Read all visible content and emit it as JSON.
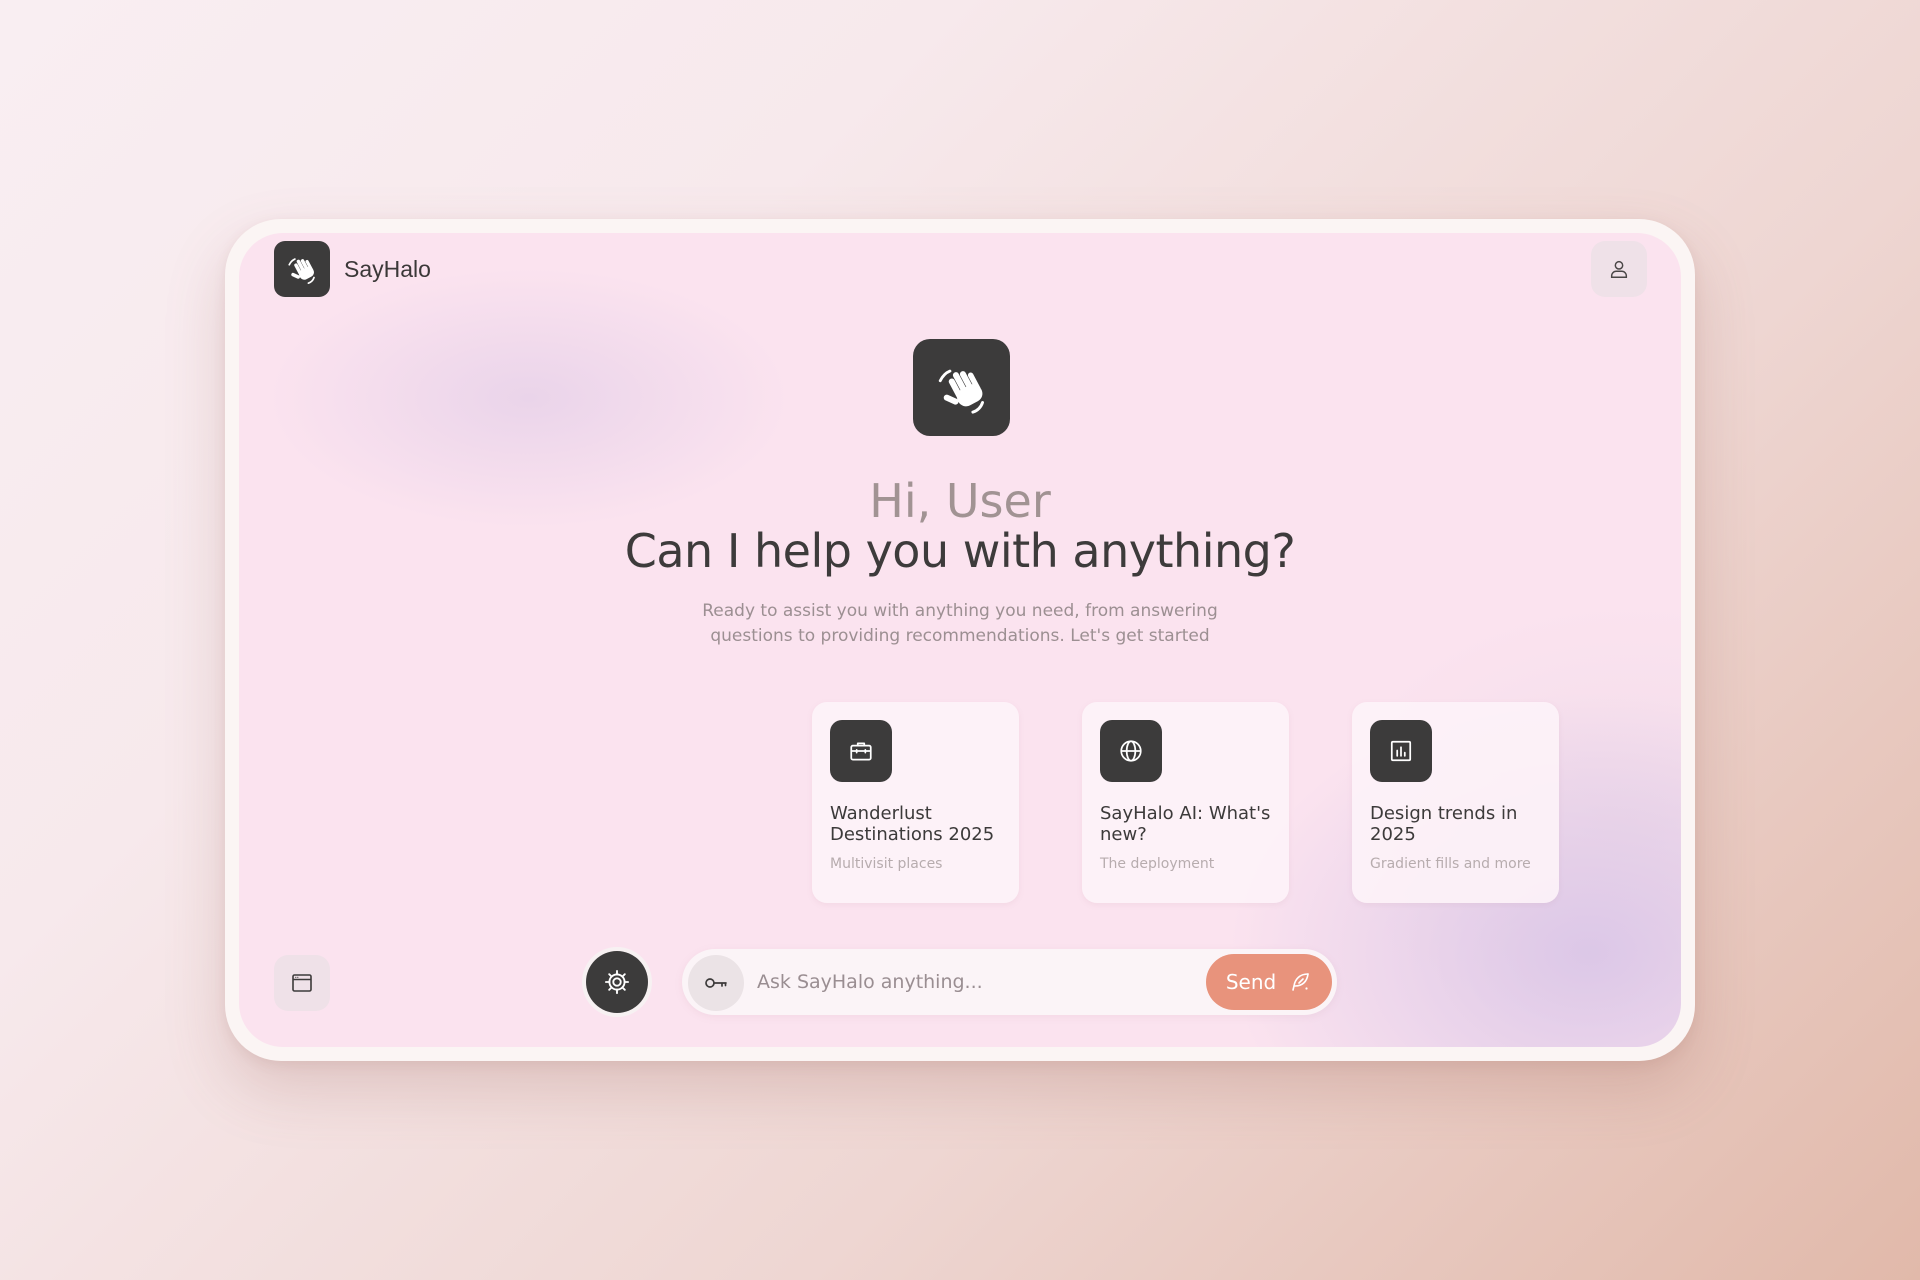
{
  "app": {
    "brand_name": "SayHalo"
  },
  "hero": {
    "greeting": "Hi, User",
    "question": "Can I help you with anything?",
    "subtitle": "Ready to assist you with anything you need, from answering questions to providing recommendations. Let's get started"
  },
  "cards": [
    {
      "icon": "briefcase-icon",
      "title": "Wanderlust Destinations 2025",
      "subtitle": "Multivisit places"
    },
    {
      "icon": "globe-icon",
      "title": "SayHalo AI: What's new?",
      "subtitle": "The deployment"
    },
    {
      "icon": "bar-chart-icon",
      "title": "Design trends in 2025",
      "subtitle": "Gradient fills and more"
    }
  ],
  "composer": {
    "placeholder": "Ask SayHalo anything...",
    "send_label": "Send"
  },
  "icons": {
    "logo": "waving-hand-icon",
    "profile": "user-icon",
    "sidebar": "browser-window-icon",
    "settings": "gear-icon",
    "key": "key-icon",
    "send": "feather-pen-icon"
  },
  "colors": {
    "accent": "#e8937c",
    "dark_tile": "#3c3b3b",
    "panel": "#fbe3ef",
    "text_primary": "#3d3b3b",
    "text_muted": "#9c8f92"
  }
}
